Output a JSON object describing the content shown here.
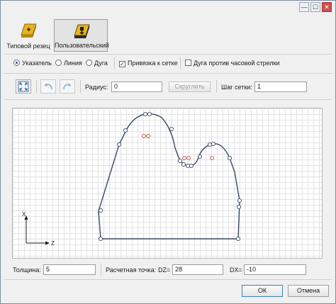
{
  "window": {
    "controls": {
      "minimize": "—",
      "maximize": "☐",
      "close": "✕"
    }
  },
  "toolbar": {
    "tools": [
      {
        "label": "Типовой резец",
        "icon": "standard-insert-icon",
        "active": false
      },
      {
        "label": "Пользовательский",
        "icon": "custom-insert-icon",
        "active": true
      }
    ]
  },
  "modes": {
    "pointer": "Указатель",
    "line": "Линия",
    "arc": "Дуга",
    "snap_to_grid": "Привязка к сетке",
    "arc_ccw": "Дуга против часовой стрелки",
    "selected": "pointer",
    "snap_checked": true,
    "ccw_checked": false
  },
  "edit": {
    "fit_icon": "fit-view-icon",
    "undo_icon": "undo-icon",
    "redo_icon": "redo-icon",
    "radius_label": "Радиус:",
    "radius_value": "0",
    "round_button": "Скруглить",
    "grid_step_label": "Шаг сетки:",
    "grid_step_value": "1"
  },
  "axes": {
    "x_label": "X",
    "z_label": "Z"
  },
  "bottom": {
    "thickness_label": "Толщина:",
    "thickness_value": "5",
    "calc_point_label": "Расчетная точка:",
    "dz_label": "DZ=",
    "dz_value": "28",
    "dx_label": "DX=",
    "dx_value": "-10"
  },
  "actions": {
    "ok": "ОК",
    "cancel": "Отмена"
  },
  "colors": {
    "profile": "#3a4a64",
    "marker": "#b84444",
    "accent": "#3c7fb1"
  }
}
